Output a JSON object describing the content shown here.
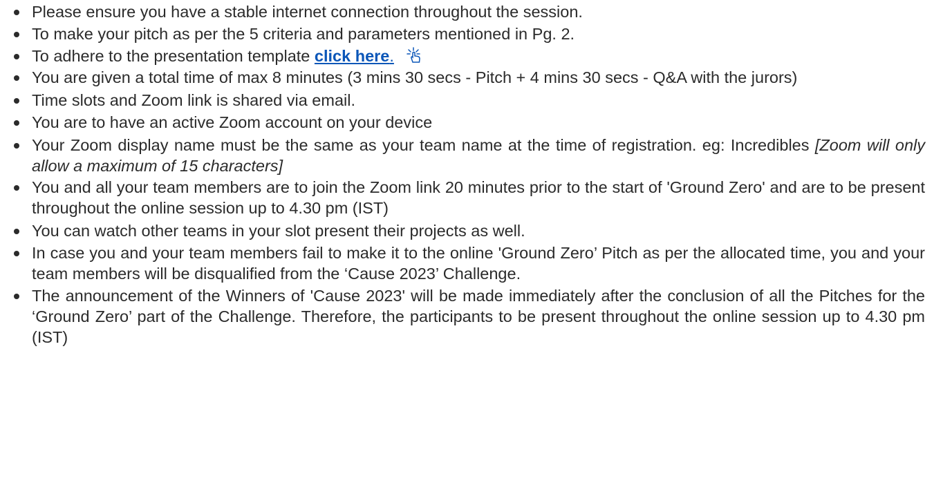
{
  "items": [
    {
      "text": "Please ensure you have a stable internet connection throughout the session."
    },
    {
      "text": "To make your pitch as per the 5 criteria and parameters mentioned in Pg. 2."
    },
    {
      "text_before": "To adhere to the presentation template ",
      "link_label": "click here",
      "link_after": ".",
      "icon": "pointer-click-icon",
      "link_color": "#0b56b8"
    },
    {
      "text": "You are given a total time of max 8 minutes (3 mins 30 secs - Pitch + 4 mins 30 secs - Q&A with the jurors)"
    },
    {
      "text": "Time slots and Zoom link is shared via email."
    },
    {
      "text": "You are to have an active Zoom account on your device"
    },
    {
      "text_before": "Your Zoom display name must be the same as your team name at the time of registration. eg: Incredibles ",
      "italic": "[Zoom will only allow a maximum of 15 characters]"
    },
    {
      "text": "You and all your team members are to join the Zoom link 20 minutes prior to the start of 'Ground Zero'  and are to be present throughout the online session up to 4.30 pm (IST)"
    },
    {
      "text": "You can watch other teams in your slot present their projects as well."
    },
    {
      "text": "In case you and your team members fail to make it to the online 'Ground Zero’ Pitch as per the allocated time, you and your team members will be disqualified from the ‘Cause 2023’ Challenge."
    },
    {
      "text": "The announcement of the Winners of 'Cause 2023' will be made immediately after the conclusion of all the Pitches for the ‘Ground Zero’ part of the Challenge. Therefore, the participants to be present throughout the online session up to 4.30 pm (IST)"
    }
  ]
}
